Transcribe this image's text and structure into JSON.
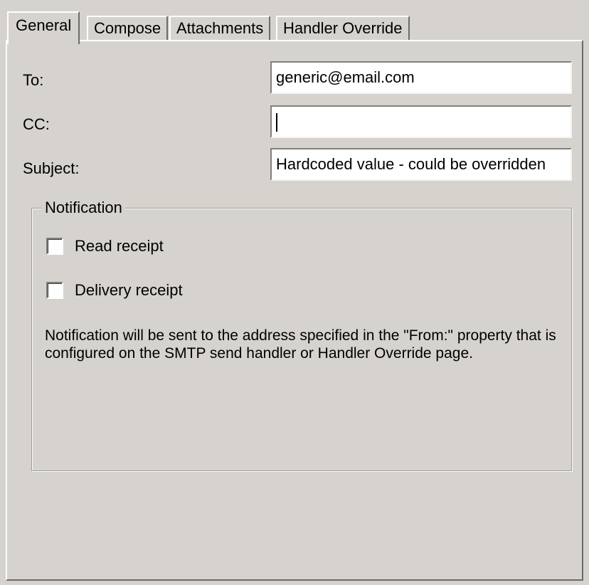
{
  "tabs": [
    {
      "label": "General",
      "active": true
    },
    {
      "label": "Compose",
      "active": false
    },
    {
      "label": "Attachments",
      "active": false
    },
    {
      "label": "Handler Override",
      "active": false
    }
  ],
  "fields": {
    "to": {
      "label": "To:",
      "value": "generic@email.com"
    },
    "cc": {
      "label": "CC:",
      "value": ""
    },
    "subject": {
      "label": "Subject:",
      "value": "Hardcoded value - could be overridden"
    }
  },
  "notification": {
    "legend": "Notification",
    "read_receipt": {
      "label": "Read receipt",
      "checked": false
    },
    "delivery_receipt": {
      "label": "Delivery receipt",
      "checked": false
    },
    "note": "Notification will be sent to the address specified in the \"From:\" property that is configured on the SMTP send handler or Handler Override page."
  },
  "colors": {
    "face": "#d6d3ce",
    "highlight": "#ffffff",
    "shadow": "#808080"
  }
}
